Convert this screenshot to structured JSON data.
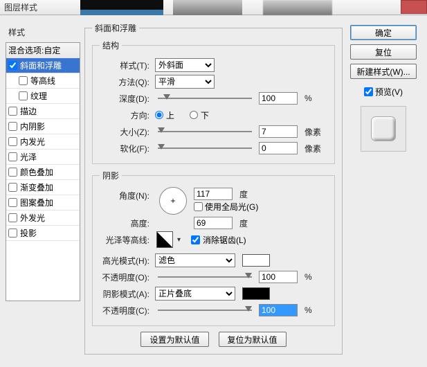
{
  "window": {
    "title": "图层样式"
  },
  "left": {
    "heading": "样式",
    "blend_options": "混合选项:自定",
    "items": [
      {
        "label": "斜面和浮雕",
        "checked": true,
        "selected": true
      },
      {
        "label": "等高线",
        "checked": false,
        "indent": true
      },
      {
        "label": "纹理",
        "checked": false,
        "indent": true
      },
      {
        "label": "描边",
        "checked": false
      },
      {
        "label": "内阴影",
        "checked": false
      },
      {
        "label": "内发光",
        "checked": false
      },
      {
        "label": "光泽",
        "checked": false
      },
      {
        "label": "颜色叠加",
        "checked": false
      },
      {
        "label": "渐变叠加",
        "checked": false
      },
      {
        "label": "图案叠加",
        "checked": false
      },
      {
        "label": "外发光",
        "checked": false
      },
      {
        "label": "投影",
        "checked": false
      }
    ]
  },
  "panel": {
    "title": "斜面和浮雕",
    "structure": {
      "legend": "结构",
      "style_label": "样式(T):",
      "style_value": "外斜面",
      "technique_label": "方法(Q):",
      "technique_value": "平滑",
      "depth_label": "深度(D):",
      "depth_value": "100",
      "depth_unit": "%",
      "direction_label": "方向:",
      "up": "上",
      "down": "下",
      "size_label": "大小(Z):",
      "size_value": "7",
      "size_unit": "像素",
      "soften_label": "软化(F):",
      "soften_value": "0",
      "soften_unit": "像素"
    },
    "shading": {
      "legend": "阴影",
      "angle_label": "角度(N):",
      "angle_value": "117",
      "angle_unit": "度",
      "global_label": "使用全局光(G)",
      "altitude_label": "高度:",
      "altitude_value": "69",
      "altitude_unit": "度",
      "gloss_label": "光泽等高线:",
      "antialias_label": "消除锯齿(L)",
      "highlight_mode_label": "高光模式(H):",
      "highlight_mode_value": "滤色",
      "highlight_opacity_label": "不透明度(O):",
      "highlight_opacity_value": "100",
      "opacity_unit": "%",
      "shadow_mode_label": "阴影模式(A):",
      "shadow_mode_value": "正片叠底",
      "shadow_opacity_label": "不透明度(C):",
      "shadow_opacity_value": "100"
    },
    "buttons": {
      "make_default": "设置为默认值",
      "reset_default": "复位为默认值"
    }
  },
  "right": {
    "ok": "确定",
    "cancel": "复位",
    "new_style": "新建样式(W)...",
    "preview_label": "预览(V)"
  }
}
